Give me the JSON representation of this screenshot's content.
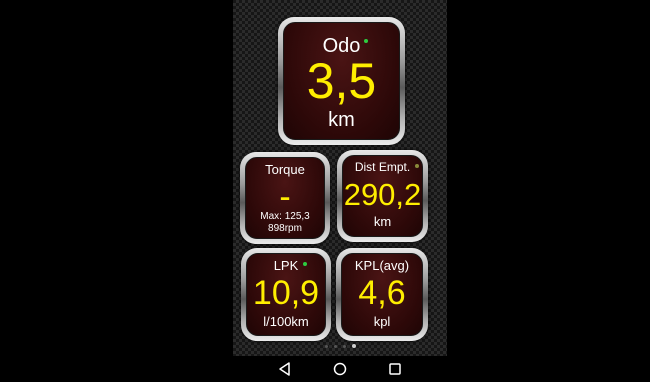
{
  "gauges": {
    "odo": {
      "title": "Odo",
      "value": "3,5",
      "unit": "km"
    },
    "torque": {
      "title": "Torque",
      "value": "-",
      "max_line": "Max: 125,3",
      "rpm_line": "898rpm"
    },
    "dist_empty": {
      "title": "Dist Empt.",
      "value": "290,2",
      "unit": "km"
    },
    "lpk": {
      "title": "LPK",
      "value": "10,9",
      "unit": "l/100km"
    },
    "kpl_avg": {
      "title": "KPL(avg)",
      "value": "4,6",
      "unit": "kpl"
    }
  },
  "colors": {
    "value": "#ffee00",
    "label": "#ffffff",
    "gauge_face": "#2c0808",
    "indicator_green": "#2ecc40",
    "indicator_olive": "#8a8a3a"
  },
  "pager": {
    "pages": 4,
    "active_index": 3
  },
  "navbar": {
    "back_icon": "back-triangle-icon",
    "home_icon": "home-circle-icon",
    "recent_icon": "recent-square-icon"
  }
}
